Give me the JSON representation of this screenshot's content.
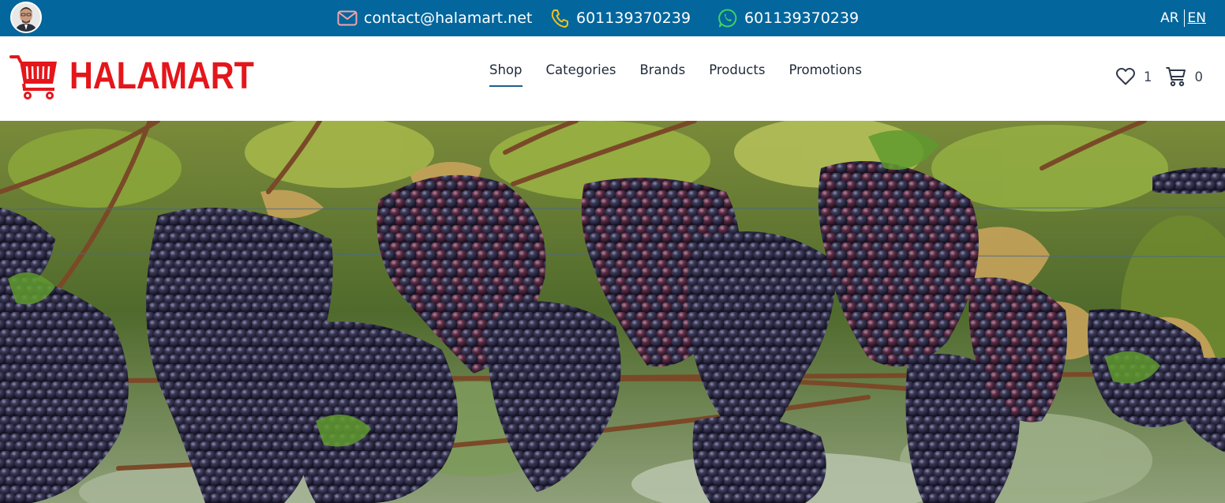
{
  "topbar": {
    "email": "contact@halamart.net",
    "phone": "601139370239",
    "whatsapp": "601139370239",
    "languages": [
      "AR",
      "EN"
    ],
    "active_language": "EN",
    "colors": {
      "background": "#03669d",
      "text": "#ffffff"
    },
    "icons": {
      "email": "mail-icon",
      "phone": "phone-icon",
      "whatsapp": "whatsapp-icon"
    }
  },
  "header": {
    "logo_text": "HALAMART",
    "brand_color": "#e4161b",
    "nav": [
      {
        "label": "Shop",
        "active": true
      },
      {
        "label": "Categories",
        "active": false
      },
      {
        "label": "Brands",
        "active": false
      },
      {
        "label": "Products",
        "active": false
      },
      {
        "label": "Promotions",
        "active": false
      }
    ],
    "wishlist_count": "1",
    "cart_count": "0",
    "icons": {
      "logo": "shopping-cart-logo-icon",
      "wishlist": "heart-icon",
      "cart": "cart-icon"
    }
  },
  "hero": {
    "image": "grape-vineyard-photo"
  }
}
